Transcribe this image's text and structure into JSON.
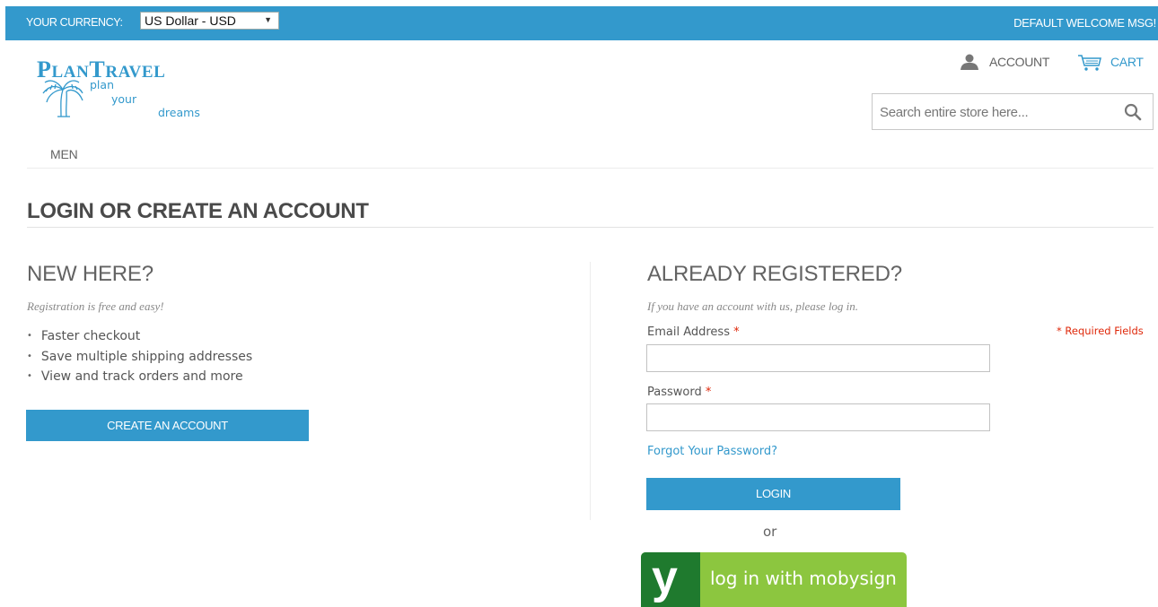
{
  "topbar": {
    "currency_label": "YOUR CURRENCY:",
    "currency_value": "US Dollar - USD",
    "welcome": "DEFAULT WELCOME MSG!"
  },
  "logo": {
    "brand_initial_1": "P",
    "brand_rest_1": "LAN",
    "brand_initial_2": "T",
    "brand_rest_2": "RAVEL",
    "tagline_1": "plan",
    "tagline_2": "your",
    "tagline_3": "dreams"
  },
  "header": {
    "account_label": "ACCOUNT",
    "cart_label": "CART",
    "search_placeholder": "Search entire store here..."
  },
  "nav": {
    "items": [
      "MEN"
    ]
  },
  "page": {
    "title": "LOGIN OR CREATE AN ACCOUNT"
  },
  "new_customer": {
    "heading": "NEW HERE?",
    "intro": "Registration is free and easy!",
    "benefits": [
      "Faster checkout",
      "Save multiple shipping addresses",
      "View and track orders and more"
    ],
    "create_button": "CREATE AN ACCOUNT"
  },
  "login": {
    "heading": "ALREADY REGISTERED?",
    "intro": "If you have an account with us, please log in.",
    "required_note": "* Required Fields",
    "email_label": "Email Address",
    "password_label": "Password",
    "required_marker": "*",
    "email_value": "",
    "password_value": "",
    "forgot_link": "Forgot Your Password?",
    "login_button": "LOGIN",
    "or_text": "or",
    "mobysign_mark": "y",
    "mobysign_text": "log in with mobysign"
  },
  "colors": {
    "accent": "#3399cc",
    "required": "#df280a",
    "mobysign_light": "#8cc63f",
    "mobysign_dark": "#1f7a2e"
  },
  "icons": [
    "chevron-down-icon",
    "palm-tree-icon",
    "user-icon",
    "cart-icon",
    "search-icon",
    "mobysign-logo-icon"
  ]
}
